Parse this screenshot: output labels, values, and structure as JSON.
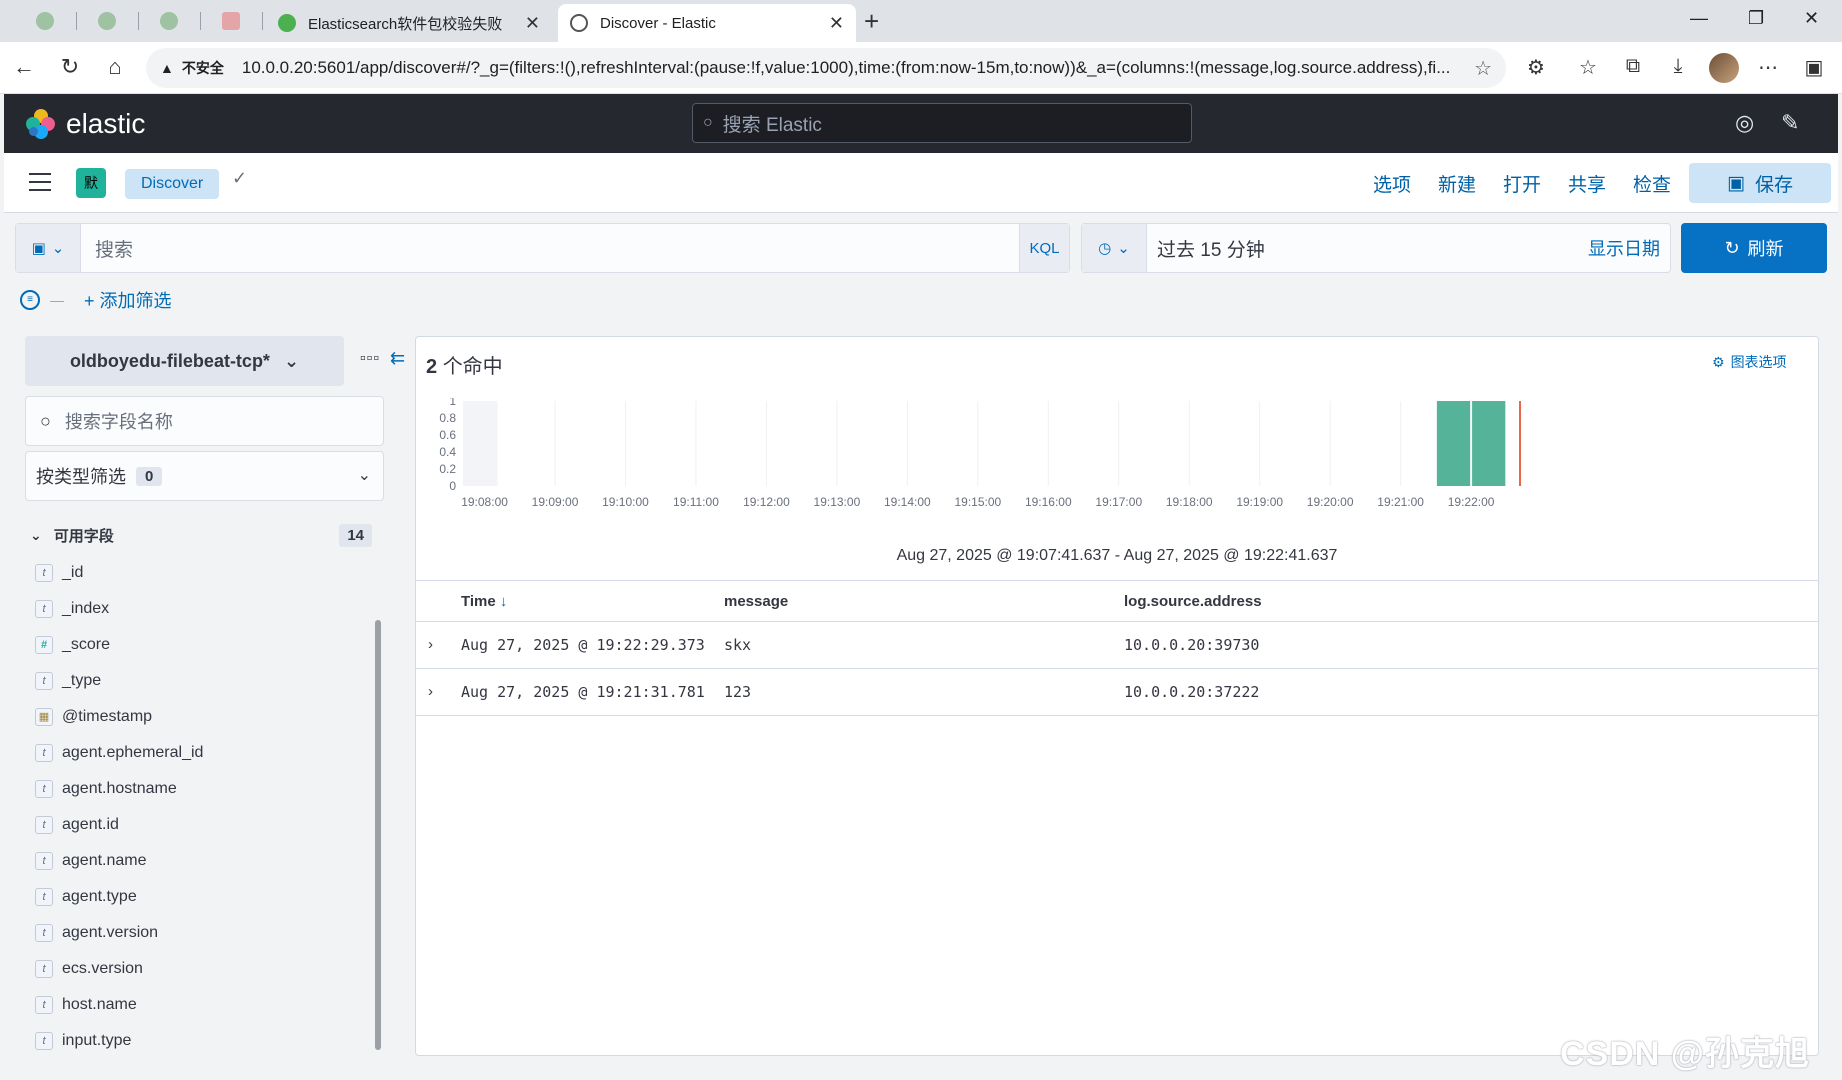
{
  "browser": {
    "tabs": [
      {
        "title": "Elasticsearch软件包校验失败"
      },
      {
        "title": "Discover - Elastic"
      }
    ],
    "url": "10.0.0.20:5601/app/discover#/?_g=(filters:!(),refreshInterval:(pause:!f,value:1000),time:(from:now-15m,to:now))&_a=(columns:!(message,log.source.address),fi...",
    "security_label": "不安全"
  },
  "header": {
    "logo_text": "elastic",
    "search_placeholder": "搜索 Elastic"
  },
  "subheader": {
    "space_initial": "默",
    "breadcrumb": "Discover",
    "links": {
      "options": "选项",
      "new": "新建",
      "open": "打开",
      "share": "共享",
      "inspect": "检查"
    },
    "save_label": "保存"
  },
  "query": {
    "placeholder": "搜索",
    "language": "KQL",
    "time_range": "过去 15 分钟",
    "show_dates": "显示日期",
    "refresh_label": "刷新",
    "add_filter": "+ 添加筛选"
  },
  "sidebar": {
    "index_pattern": "oldboyedu-filebeat-tcp*",
    "field_search_placeholder": "搜索字段名称",
    "type_filter_label": "按类型筛选",
    "type_filter_count": "0",
    "available_label": "可用字段",
    "available_count": "14",
    "fields": [
      {
        "name": "_id",
        "type": "t"
      },
      {
        "name": "_index",
        "type": "t"
      },
      {
        "name": "_score",
        "type": "#"
      },
      {
        "name": "_type",
        "type": "t"
      },
      {
        "name": "@timestamp",
        "type": "date"
      },
      {
        "name": "agent.ephemeral_id",
        "type": "t"
      },
      {
        "name": "agent.hostname",
        "type": "t"
      },
      {
        "name": "agent.id",
        "type": "t"
      },
      {
        "name": "agent.name",
        "type": "t"
      },
      {
        "name": "agent.type",
        "type": "t"
      },
      {
        "name": "agent.version",
        "type": "t"
      },
      {
        "name": "ecs.version",
        "type": "t"
      },
      {
        "name": "host.name",
        "type": "t"
      },
      {
        "name": "input.type",
        "type": "t"
      }
    ]
  },
  "results": {
    "hits_count": "2",
    "hits_suffix": "个命中",
    "chart_options_label": "图表选项",
    "range_text": "Aug 27, 2025 @ 19:07:41.637 - Aug 27, 2025 @ 19:22:41.637",
    "columns": [
      "Time",
      "message",
      "log.source.address"
    ],
    "rows": [
      {
        "time": "Aug 27, 2025 @ 19:22:29.373",
        "message": "skx",
        "address": "10.0.0.20:39730"
      },
      {
        "time": "Aug 27, 2025 @ 19:21:31.781",
        "message": "123",
        "address": "10.0.0.20:37222"
      }
    ]
  },
  "chart_data": {
    "type": "bar",
    "x_ticks": [
      "19:08:00",
      "19:09:00",
      "19:10:00",
      "19:11:00",
      "19:12:00",
      "19:13:00",
      "19:14:00",
      "19:15:00",
      "19:16:00",
      "19:17:00",
      "19:18:00",
      "19:19:00",
      "19:20:00",
      "19:21:00",
      "19:22:00"
    ],
    "y_ticks": [
      "0",
      "0.2",
      "0.4",
      "0.6",
      "0.8",
      "1"
    ],
    "ylim": [
      0,
      1
    ],
    "xlim": [
      "19:07:41.637",
      "19:22:41.637"
    ],
    "bars": [
      {
        "x_start": "19:21:30",
        "x_end": "19:22:00",
        "value": 1
      },
      {
        "x_start": "19:22:00",
        "x_end": "19:22:30",
        "value": 1
      }
    ],
    "bar_color": "#54b399",
    "now_marker": "19:22:41.637",
    "now_marker_color": "#e7664c"
  },
  "watermark": "CSDN @孙克旭"
}
